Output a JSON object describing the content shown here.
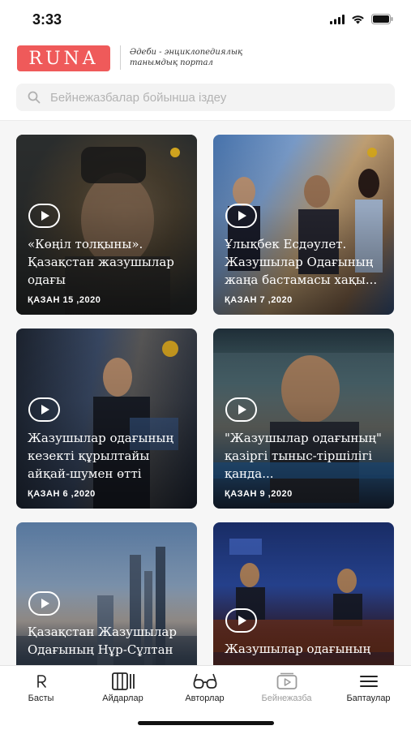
{
  "status_bar": {
    "time": "3:33"
  },
  "header": {
    "logo_text": "RUNA",
    "tagline": "Әдеби - энциклопедиялық танымдық портал"
  },
  "search": {
    "placeholder": "Бейнежазбалар бойынша іздеу"
  },
  "videos": [
    {
      "title": "«Көңіл толқыны». Қазақстан жазушылар одағы",
      "date": "ҚАЗАН 15 ,2020"
    },
    {
      "title": "Ұлықбек Есдәулет. Жазушылар Одағының жаңа бастамасы хақы...",
      "date": "ҚАЗАН 7 ,2020"
    },
    {
      "title": "Жазушылар одағының кезекті құрылтайы айқай-шумен өтті",
      "date": "ҚАЗАН 6 ,2020"
    },
    {
      "title": "\"Жазушылар одағының\" қазіргі тыныс-тіршілігі қанда...",
      "date": "ҚАЗАН 9 ,2020"
    },
    {
      "title": "Қазақстан Жазушылар Одағының Нұр-Сұлтан",
      "date": ""
    },
    {
      "title": "Жазушылар одағының",
      "date": ""
    }
  ],
  "tabbar": {
    "items": [
      {
        "label": "Басты",
        "icon": "runa-logo-icon"
      },
      {
        "label": "Айдарлар",
        "icon": "columns-icon"
      },
      {
        "label": "Авторлар",
        "icon": "glasses-icon"
      },
      {
        "label": "Бейнежазба",
        "icon": "video-play-icon",
        "active": true
      },
      {
        "label": "Баптаулар",
        "icon": "menu-icon"
      }
    ]
  },
  "colors": {
    "brand": "#ef5a5a",
    "active_tab": "#9c9c9c"
  }
}
